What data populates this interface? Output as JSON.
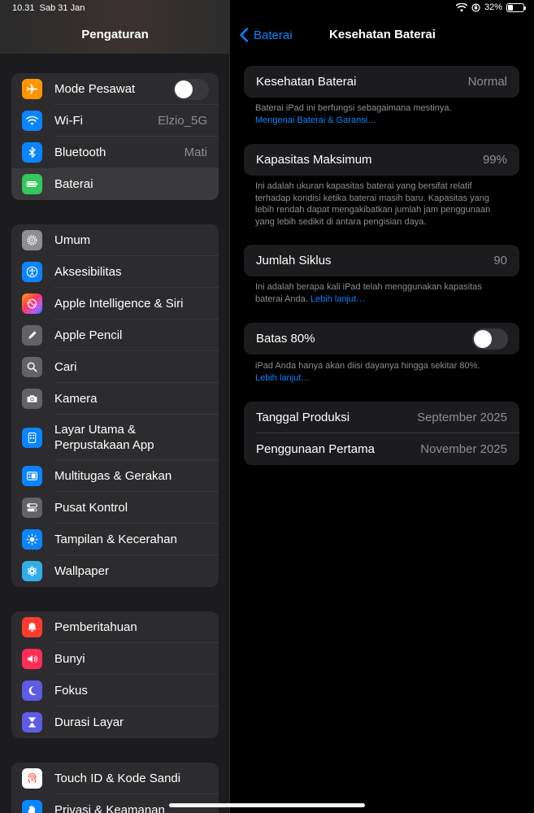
{
  "status_bar": {
    "time": "10.31",
    "date": "Sab 31 Jan",
    "battery": "32%",
    "battery_level": 0.32
  },
  "sidebar": {
    "title": "Pengaturan",
    "groups": [
      {
        "items": [
          {
            "label": "Mode Pesawat",
            "icon": "airplane-icon",
            "color": "#ff9500",
            "toggle": false
          },
          {
            "label": "Wi-Fi",
            "value": "Elzio_5G",
            "icon": "wifi-icon",
            "color": "#0a84ff"
          },
          {
            "label": "Bluetooth",
            "value": "Mati",
            "icon": "bluetooth-icon",
            "color": "#0a84ff"
          },
          {
            "label": "Baterai",
            "icon": "battery-icon",
            "color": "#34c759",
            "selected": true
          }
        ]
      },
      {
        "items": [
          {
            "label": "Umum",
            "icon": "gear-icon",
            "color": "#8e8e93"
          },
          {
            "label": "Aksesibilitas",
            "icon": "accessibility-icon",
            "color": "#0a84ff"
          },
          {
            "label": "Apple Intelligence & Siri",
            "icon": "siri-icon",
            "color": "#c44dd6"
          },
          {
            "label": "Apple Pencil",
            "icon": "pencil-icon",
            "color": "#636366"
          },
          {
            "label": "Cari",
            "icon": "search-icon",
            "color": "#636366"
          },
          {
            "label": "Kamera",
            "icon": "camera-icon",
            "color": "#636366"
          },
          {
            "label": "Layar Utama & Perpustakaan App",
            "label_line1": "Layar Utama &",
            "label_line2": "Perpustakaan App",
            "icon": "home-screen-icon",
            "color": "#0a84ff"
          },
          {
            "label": "Multitugas & Gerakan",
            "icon": "multitasking-icon",
            "color": "#0a84ff"
          },
          {
            "label": "Pusat Kontrol",
            "icon": "control-center-icon",
            "color": "#636366"
          },
          {
            "label": "Tampilan & Kecerahan",
            "icon": "brightness-icon",
            "color": "#0a84ff"
          },
          {
            "label": "Wallpaper",
            "icon": "wallpaper-icon",
            "color": "#32ade6"
          }
        ]
      },
      {
        "items": [
          {
            "label": "Pemberitahuan",
            "icon": "notifications-icon",
            "color": "#ff3b30"
          },
          {
            "label": "Bunyi",
            "icon": "sound-icon",
            "color": "#ff2d55"
          },
          {
            "label": "Fokus",
            "icon": "focus-moon-icon",
            "color": "#5e5ce6"
          },
          {
            "label": "Durasi Layar",
            "icon": "hourglass-icon",
            "color": "#5e5ce6"
          }
        ]
      },
      {
        "items": [
          {
            "label": "Touch ID & Kode Sandi",
            "icon": "fingerprint-icon",
            "color": "#ffffff"
          },
          {
            "label": "Privasi & Keamanan",
            "icon": "privacy-hand-icon",
            "color": "#0a84ff"
          }
        ]
      }
    ]
  },
  "detail": {
    "back_label": "Baterai",
    "title": "Kesehatan Baterai",
    "health": {
      "label": "Kesehatan Baterai",
      "value": "Normal",
      "footer": "Baterai iPad ini berfungsi sebagaimana mestinya.",
      "footer_link": "Mengenai Baterai & Garansi…"
    },
    "capacity": {
      "label": "Kapasitas Maksimum",
      "value": "99%",
      "footer": "Ini adalah ukuran kapasitas baterai yang bersifat relatif terhadap kondisi ketika baterai masih baru. Kapasitas yang lebih rendah dapat mengakibatkan jumlah jam penggunaan yang lebih sedikit di antara pengisian daya."
    },
    "cycles": {
      "label": "Jumlah Siklus",
      "value": "90",
      "footer": "Ini adalah berapa kali iPad telah menggunakan kapasitas baterai Anda.",
      "footer_link": "Lebih lanjut…"
    },
    "limit": {
      "label": "Batas 80%",
      "toggle": false,
      "footer": "iPad Anda hanya akan diisi dayanya hingga sekitar 80%.",
      "footer_link": "Lebih lanjut…"
    },
    "dates": [
      {
        "label": "Tanggal Produksi",
        "value": "September 2025"
      },
      {
        "label": "Penggunaan Pertama",
        "value": "November 2025"
      }
    ]
  }
}
